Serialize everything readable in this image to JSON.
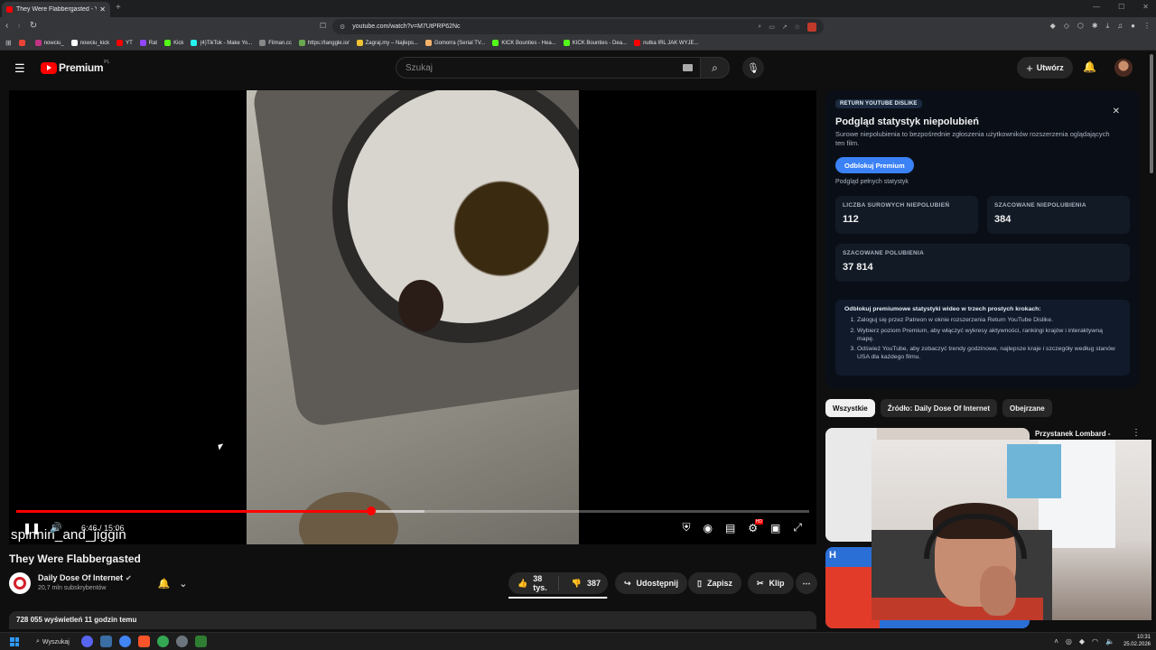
{
  "browser": {
    "tab_title": "They Were Flabbergasted - Yo...",
    "new_tab": "+",
    "url": "youtube.com/watch?v=M7UtPRP62Nc",
    "bookmarks": [
      {
        "label": "",
        "color": "#ea4335"
      },
      {
        "label": "nowciu_",
        "color": "#c13584"
      },
      {
        "label": "nowciu_kick",
        "color": "#ffffff"
      },
      {
        "label": "YT",
        "color": "#ff0000"
      },
      {
        "label": "Rat",
        "color": "#9146ff"
      },
      {
        "label": "Kick",
        "color": "#53fc18"
      },
      {
        "label": "(4)TikTok - Make Yo...",
        "color": "#25f4ee"
      },
      {
        "label": "Filman.cc",
        "color": "#888888"
      },
      {
        "label": "https://tanggle.io/",
        "color": "#6aa84f"
      },
      {
        "label": "Zagraj.my – Najleps...",
        "color": "#f1c232"
      },
      {
        "label": "Gomorra (Serial TV...",
        "color": "#f6b26b"
      },
      {
        "label": "KICK Bounties - Hea...",
        "color": "#53fc18"
      },
      {
        "label": "KICK Bounties - Dea...",
        "color": "#53fc18"
      },
      {
        "label": "nutka IRL JAK WYJE...",
        "color": "#ff0000"
      }
    ]
  },
  "masthead": {
    "logo_text": "Premium",
    "logo_region": "PL",
    "search_placeholder": "Szukaj",
    "create_label": "Utwórz"
  },
  "player": {
    "current_time": "6:46",
    "duration": "15:06",
    "time_display": "6:46 / 15:06",
    "played_fraction": 0.448,
    "buffered_fraction": 0.515,
    "overlay_username": "spinnin_and_jiggin"
  },
  "video": {
    "title": "They Were Flabbergasted",
    "channel_name": "Daily Dose Of Internet",
    "subscribers": "20,7 mln subskrybentów",
    "likes": "38 tys.",
    "dislikes": "387",
    "like_ratio": 0.99,
    "share_label": "Udostępnij",
    "save_label": "Zapisz",
    "clip_label": "Klip",
    "views_date": "728 055 wyświetleń  11 godzin temu"
  },
  "ryd": {
    "badge": "RETURN YOUTUBE DISLIKE",
    "heading": "Podgląd statystyk niepolubień",
    "subtitle": "Surowe niepolubienia to bezpośrednie zgłoszenia użytkowników rozszerzenia oglądających ten film.",
    "unlock_button": "Odblokuj Premium",
    "full_stats_link": "Podgląd pełnych statystyk",
    "stats": [
      {
        "label": "LICZBA SUROWYCH NIEPOLUBIEŃ",
        "value": "112"
      },
      {
        "label": "SZACOWANE NIEPOLUBIENIA",
        "value": "384"
      },
      {
        "label": "SZACOWANE POLUBIENIA",
        "value": "37 814"
      }
    ],
    "steps_heading": "Odblokuj premiumowe statystyki wideo w trzech prostych krokach:",
    "steps": [
      "Zaloguj się przez Patreon w oknie rozszerzenia Return YouTube Dislike.",
      "Wybierz poziom Premium, aby włączyć wykresy aktywności, rankingi krajów i interaktywną mapę.",
      "Odśwież YouTube, aby zobaczyć trendy godzinowe, najlepsze kraje i szczegóły według stanów USA dla każdego filmu."
    ]
  },
  "related": {
    "chips": [
      "Wszystkie",
      "Źródło: Daily Dose Of Internet",
      "Obejrzane"
    ],
    "first_title": "Przystanek Lombard -",
    "second_thumb_text": "H"
  },
  "taskbar": {
    "search_label": "Wyszukaj",
    "time": "10:31",
    "date": "25.02.2026"
  }
}
